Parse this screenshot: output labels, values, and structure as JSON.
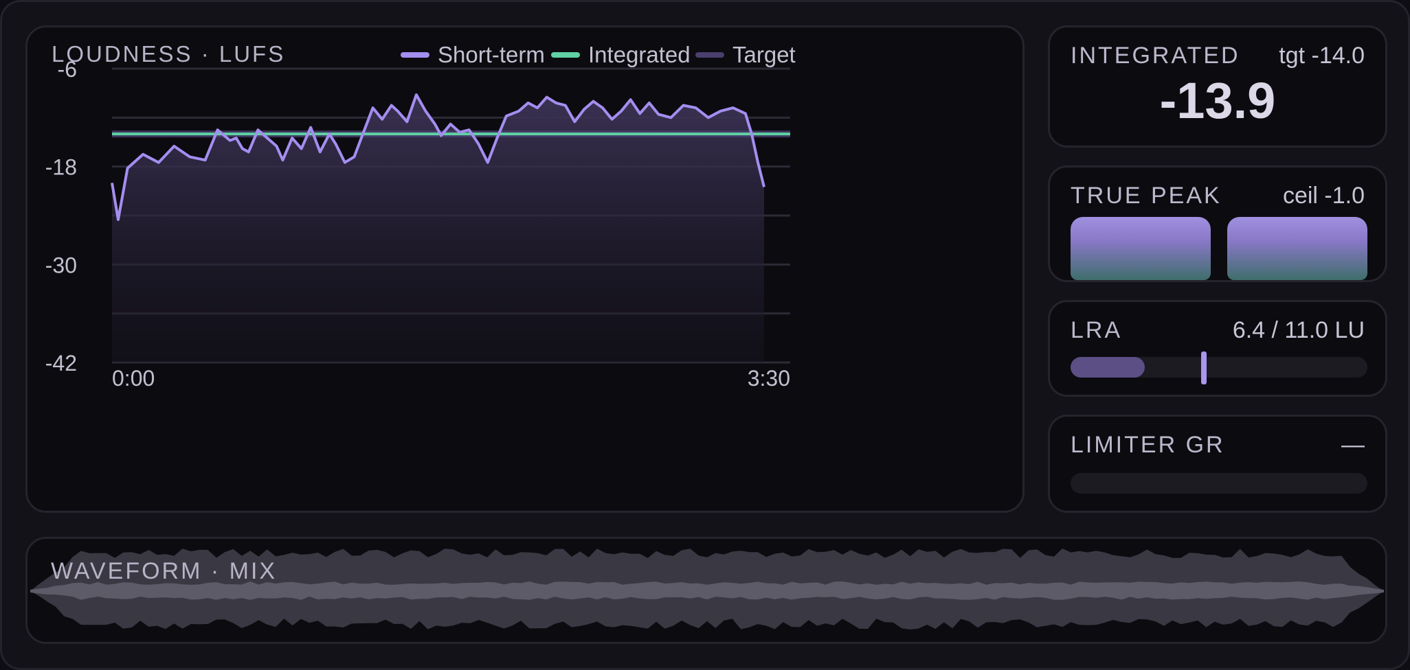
{
  "chart_data": {
    "type": "line",
    "title": "LOUDNESS · LUFS",
    "ylim": [
      -42,
      -6
    ],
    "yticks": [
      -6,
      -18,
      -30,
      -42
    ],
    "grid_y": [
      -6,
      -12,
      -18,
      -24,
      -30,
      -36,
      -42
    ],
    "xticks": [
      "0:00",
      "3:30"
    ],
    "legend": {
      "placement": "top-right"
    },
    "series": [
      {
        "name": "Short-term",
        "color": "#a48ef0",
        "x_seconds": [
          0,
          2,
          5,
          10,
          15,
          20,
          25,
          30,
          34,
          38,
          40,
          42,
          44,
          47,
          50,
          53,
          55,
          58,
          61,
          64,
          67,
          70,
          72,
          75,
          78,
          81,
          84,
          87,
          90,
          92,
          95,
          98,
          101,
          104,
          106,
          109,
          112,
          115,
          118,
          121,
          124,
          127,
          131,
          134,
          137,
          140,
          143,
          146,
          149,
          152,
          155,
          158,
          161,
          164,
          167,
          170,
          173,
          176,
          180,
          184,
          188,
          192,
          196,
          200,
          204,
          206,
          208,
          210
        ],
        "values": [
          -20,
          -24.5,
          -18.2,
          -16.5,
          -17.5,
          -15.5,
          -16.8,
          -17.2,
          -13.5,
          -14.8,
          -14.5,
          -15.8,
          -16.2,
          -13.5,
          -14.5,
          -15.5,
          -17.2,
          -14.5,
          -15.8,
          -13.2,
          -16.2,
          -14.0,
          -15.2,
          -17.5,
          -16.8,
          -13.8,
          -10.8,
          -12.2,
          -10.5,
          -11.2,
          -12.5,
          -9.2,
          -11.2,
          -12.8,
          -14.2,
          -12.8,
          -13.8,
          -13.5,
          -15.2,
          -17.5,
          -14.5,
          -11.8,
          -11.2,
          -10.2,
          -10.8,
          -9.5,
          -10.2,
          -10.5,
          -12.5,
          -11.0,
          -10.0,
          -10.8,
          -12.2,
          -11.2,
          -9.8,
          -11.5,
          -10.2,
          -11.6,
          -12.0,
          -10.5,
          -10.8,
          -12.0,
          -11.2,
          -10.8,
          -11.5,
          -14.0,
          -17.5,
          -20.5
        ]
      },
      {
        "name": "Integrated",
        "color": "#5fd1a3",
        "value": -14.0
      },
      {
        "name": "Target",
        "color": "#4a3f6e",
        "value": -14.0
      }
    ]
  },
  "meters": {
    "integrated": {
      "label": "INTEGRATED",
      "target": "tgt -14.0",
      "value": "-13.9"
    },
    "true_peak": {
      "label": "TRUE PEAK",
      "ceiling": "ceil -1.0",
      "left_level": 1.0,
      "right_level": 1.0
    },
    "lra": {
      "label": "LRA",
      "readout": "6.4 / 11.0 LU",
      "value": 6.4,
      "max": 11.0,
      "fill_fraction": 0.25,
      "marker_fraction": 0.45
    },
    "limiter": {
      "label": "LIMITER GR",
      "readout": "—"
    }
  },
  "waveform": {
    "title": "WAVEFORM · MIX"
  },
  "colors": {
    "accent": "#a48ef0",
    "integrated": "#5fd1a3",
    "target": "#4a3f6e",
    "panel": "#0c0b10",
    "border": "#25242c"
  }
}
